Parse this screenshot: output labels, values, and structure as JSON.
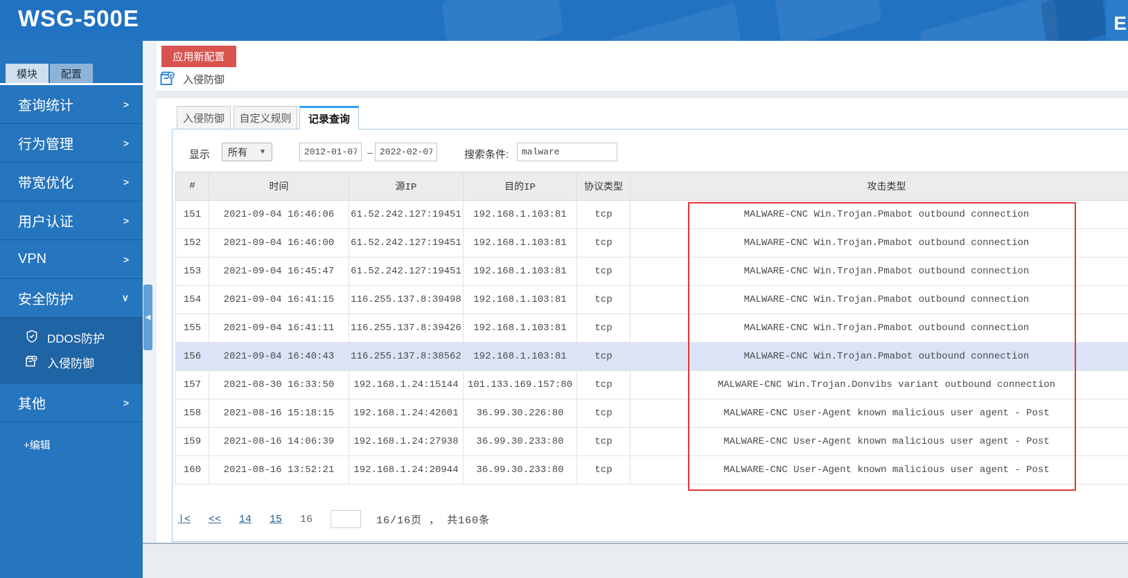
{
  "header": {
    "title": "WSG-500E",
    "right_text": "E"
  },
  "sidebar": {
    "tabs": [
      {
        "label": "模块",
        "active": true
      },
      {
        "label": "配置",
        "active": false
      }
    ],
    "items": [
      {
        "label": "查询统计",
        "chevron": ">"
      },
      {
        "label": "行为管理",
        "chevron": ">"
      },
      {
        "label": "带宽优化",
        "chevron": ">"
      },
      {
        "label": "用户认证",
        "chevron": ">"
      },
      {
        "label": "VPN",
        "chevron": ">"
      },
      {
        "label": "安全防护",
        "chevron": "∨"
      }
    ],
    "submenu": [
      {
        "label": "DDOS防护",
        "icon": "shield-check-icon"
      },
      {
        "label": "入侵防御",
        "icon": "box-badge-icon"
      }
    ],
    "items_after": [
      {
        "label": "其他",
        "chevron": ">"
      }
    ],
    "edit_label": "+编辑"
  },
  "toolbar": {
    "apply_button": "应用新配置",
    "breadcrumb": "入侵防御"
  },
  "tabs": [
    {
      "label": "入侵防御",
      "active": false
    },
    {
      "label": "自定义规则",
      "active": false
    },
    {
      "label": "记录查询",
      "active": true
    }
  ],
  "filters": {
    "show_label": "显示",
    "show_value": "所有",
    "date_from": "2012-01-07",
    "date_separator": "–",
    "date_to": "2022-02-07",
    "search_label": "搜索条件:",
    "search_value": "malware"
  },
  "table": {
    "columns": [
      "#",
      "时间",
      "源IP",
      "目的IP",
      "协议类型",
      "攻击类型"
    ],
    "rows": [
      [
        "151",
        "2021-09-04 16:46:06",
        "61.52.242.127:19451",
        "192.168.1.103:81",
        "tcp",
        "MALWARE-CNC Win.Trojan.Pmabot outbound connection"
      ],
      [
        "152",
        "2021-09-04 16:46:00",
        "61.52.242.127:19451",
        "192.168.1.103:81",
        "tcp",
        "MALWARE-CNC Win.Trojan.Pmabot outbound connection"
      ],
      [
        "153",
        "2021-09-04 16:45:47",
        "61.52.242.127:19451",
        "192.168.1.103:81",
        "tcp",
        "MALWARE-CNC Win.Trojan.Pmabot outbound connection"
      ],
      [
        "154",
        "2021-09-04 16:41:15",
        "116.255.137.8:39498",
        "192.168.1.103:81",
        "tcp",
        "MALWARE-CNC Win.Trojan.Pmabot outbound connection"
      ],
      [
        "155",
        "2021-09-04 16:41:11",
        "116.255.137.8:39426",
        "192.168.1.103:81",
        "tcp",
        "MALWARE-CNC Win.Trojan.Pmabot outbound connection"
      ],
      [
        "156",
        "2021-09-04 16:40:43",
        "116.255.137.8:38562",
        "192.168.1.103:81",
        "tcp",
        "MALWARE-CNC Win.Trojan.Pmabot outbound connection"
      ],
      [
        "157",
        "2021-08-30 16:33:50",
        "192.168.1.24:15144",
        "101.133.169.157:80",
        "tcp",
        "MALWARE-CNC Win.Trojan.Donvibs variant outbound connection"
      ],
      [
        "158",
        "2021-08-16 15:18:15",
        "192.168.1.24:42601",
        "36.99.30.226:80",
        "tcp",
        "MALWARE-CNC User-Agent known malicious user agent - Post"
      ],
      [
        "159",
        "2021-08-16 14:06:39",
        "192.168.1.24:27938",
        "36.99.30.233:80",
        "tcp",
        "MALWARE-CNC User-Agent known malicious user agent - Post"
      ],
      [
        "160",
        "2021-08-16 13:52:21",
        "192.168.1.24:20944",
        "36.99.30.233:80",
        "tcp",
        "MALWARE-CNC User-Agent known malicious user agent - Post"
      ]
    ],
    "highlighted_row": 5
  },
  "pagination": {
    "first_label": "|<",
    "prev_label": "<<",
    "pages": [
      "14",
      "15"
    ],
    "current": "16",
    "input_value": "",
    "summary": "16/16页 ， 共160条"
  },
  "colors": {
    "header_blue": "#2173c2",
    "sidebar_blue": "#2575bf",
    "submenu_blue": "#1f64a5",
    "apply_red": "#d9534f",
    "active_tab_bar": "#2f9cf0",
    "highlight_row": "#dbe3f6",
    "annotation_red": "#e23434",
    "link_blue": "#1f5e94"
  }
}
